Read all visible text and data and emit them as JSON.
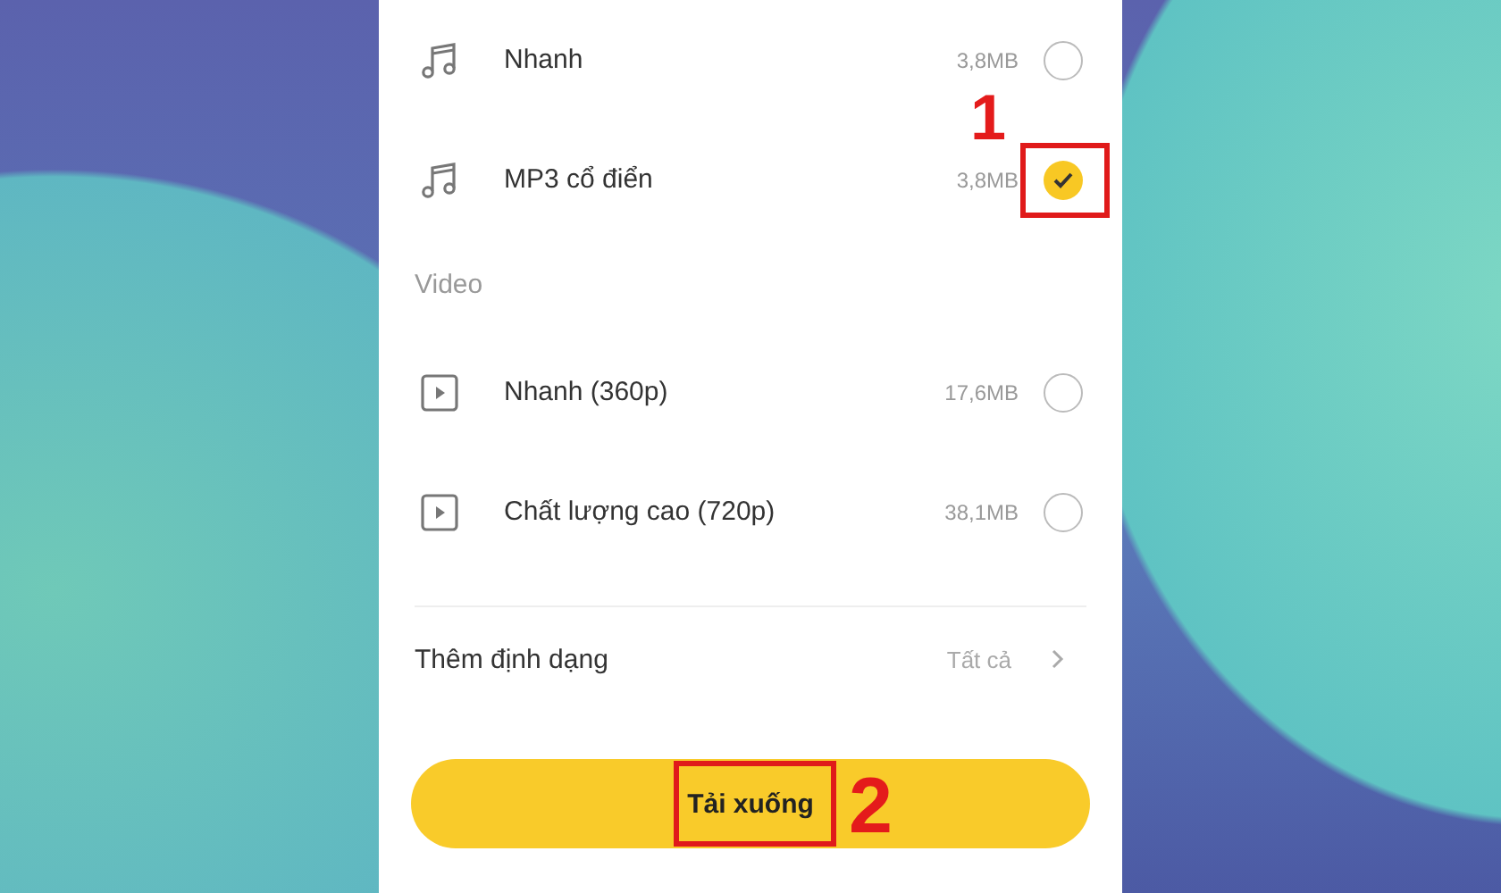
{
  "sections": [
    {
      "items": [
        {
          "kind": "audio",
          "label": "Nhanh",
          "size": "3,8MB",
          "selected": false
        },
        {
          "kind": "audio",
          "label": "MP3 cổ điển",
          "size": "3,8MB",
          "selected": true,
          "callout": "1"
        }
      ]
    },
    {
      "header": "Video",
      "items": [
        {
          "kind": "video",
          "label": "Nhanh (360p)",
          "size": "17,6MB",
          "selected": false
        },
        {
          "kind": "video",
          "label": "Chất lượng cao (720p)",
          "size": "38,1MB",
          "selected": false
        }
      ]
    }
  ],
  "more_formats": {
    "label": "Thêm định dạng",
    "value": "Tất cả"
  },
  "download_button": {
    "label": "Tải xuống",
    "callout": "2"
  }
}
